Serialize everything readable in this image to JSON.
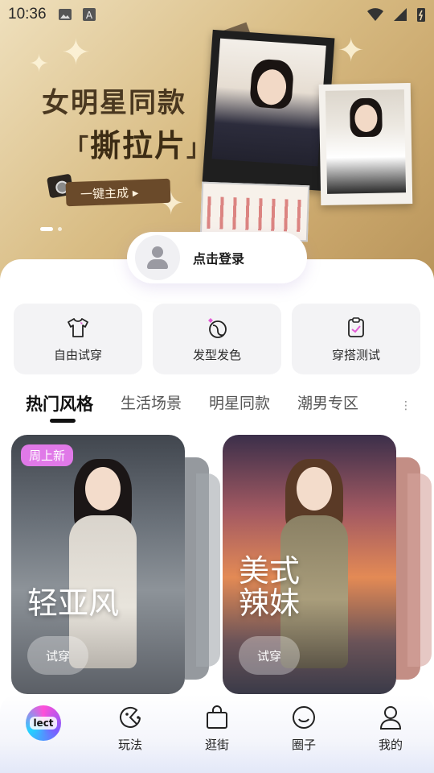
{
  "status_bar": {
    "time": "10:36"
  },
  "banner": {
    "title": "女明星同款",
    "subtitle_open": "「",
    "subtitle": "撕拉片",
    "subtitle_close": "」",
    "cta": "一键主成 ▸"
  },
  "login": {
    "label": "点击登录"
  },
  "features": [
    {
      "label": "自由试穿",
      "icon": "tshirt-icon"
    },
    {
      "label": "发型发色",
      "icon": "hair-color-icon"
    },
    {
      "label": "穿搭测试",
      "icon": "clipboard-check-icon"
    }
  ],
  "tabs": [
    "热门风格",
    "生活场景",
    "明星同款",
    "潮男专区"
  ],
  "cards": [
    {
      "title": "轻亚风",
      "badge": "周上新",
      "button": "试穿"
    },
    {
      "title_line1": "美式",
      "title_line2": "辣妹",
      "button": "试穿"
    }
  ],
  "bottom_nav": {
    "logo": "lect",
    "items": [
      "玩法",
      "逛街",
      "圈子",
      "我的"
    ]
  }
}
